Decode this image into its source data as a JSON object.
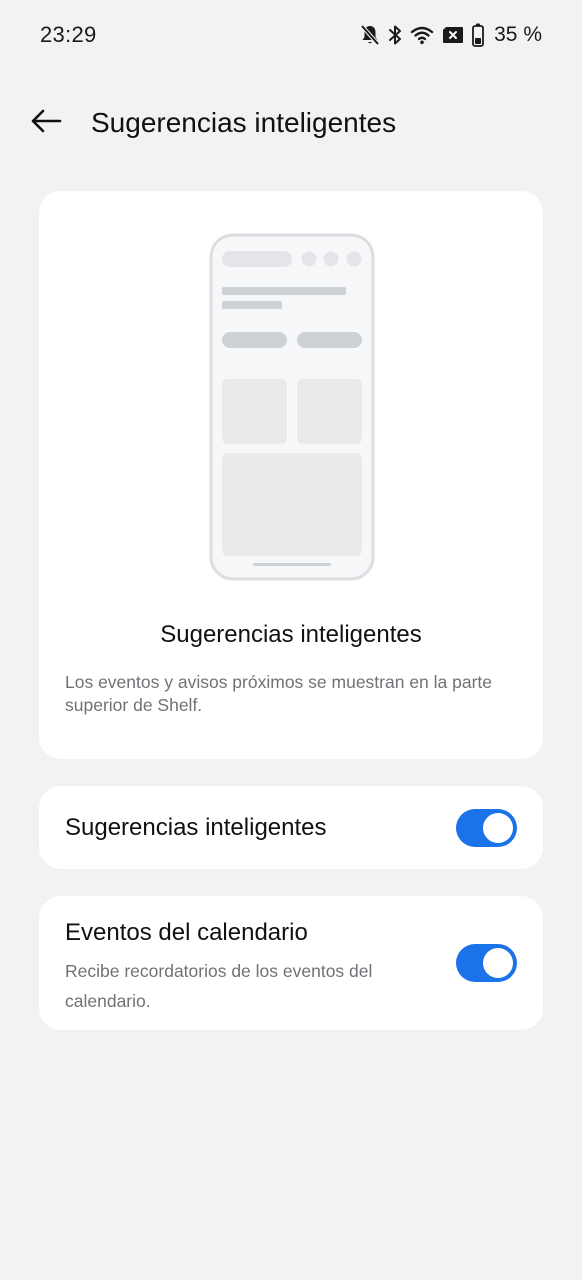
{
  "status_bar": {
    "time": "23:29",
    "icons": [
      "mute-bell-icon",
      "bluetooth-icon",
      "wifi-icon",
      "sim-disabled-icon",
      "battery-icon"
    ],
    "battery_percent": "35 %"
  },
  "app_bar": {
    "back_icon": "arrow-left-icon",
    "title": "Sugerencias inteligentes"
  },
  "hero_card": {
    "illustration": "phone-layout-illustration",
    "title": "Sugerencias inteligentes",
    "description": "Los eventos y avisos próximos se muestran en la parte superior de Shelf."
  },
  "settings": [
    {
      "title": "Sugerencias inteligentes",
      "description": "",
      "enabled": true
    },
    {
      "title": "Eventos del calendario",
      "description": "Recibe recordatorios de los eventos del calendario.",
      "enabled": true
    }
  ],
  "colors": {
    "background": "#f1f2f4",
    "card": "#ffffff",
    "accent": "#1a73e8",
    "secondary_text": "#6f7276"
  }
}
